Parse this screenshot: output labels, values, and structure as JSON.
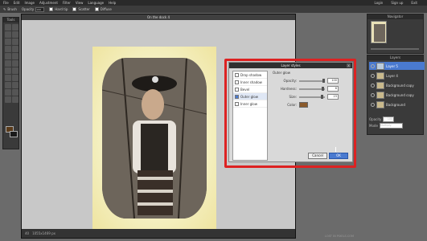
{
  "menubar": {
    "items": [
      "File",
      "Edit",
      "Image",
      "Adjustment",
      "Filter",
      "View",
      "Language",
      "Help"
    ],
    "right": [
      "Login",
      "Sign up",
      "Exit"
    ]
  },
  "options": {
    "brush_label": "Brush",
    "opacity_label": "Opacity",
    "opacity_value": "100",
    "hard_tip": "Hard tip",
    "scatter": "Scatter",
    "diffuse": "Diffuse"
  },
  "tools": {
    "title": "Tools"
  },
  "document": {
    "title": "On the dock 4",
    "zoom": "40",
    "dims": "1055x1469 px"
  },
  "dialog": {
    "title": "Layer styles",
    "close": "x",
    "styles": [
      {
        "label": "Drop shadow",
        "checked": false
      },
      {
        "label": "Inner shadow",
        "checked": false
      },
      {
        "label": "Bevel",
        "checked": false
      },
      {
        "label": "Outer glow",
        "checked": true
      },
      {
        "label": "Inner glow",
        "checked": false
      }
    ],
    "section": "Outer glow",
    "opacity_label": "Opacity:",
    "opacity_value": "100",
    "hardness_label": "Hardness:",
    "hardness_value": "6",
    "size_label": "Size:",
    "size_value": "23",
    "color_label": "Color:",
    "color_value": "#8a5a2b",
    "cancel": "Cancel",
    "ok": "OK"
  },
  "navigator": {
    "title": "Navigator"
  },
  "layers": {
    "title": "Layers",
    "rows": [
      {
        "label": "Layer 5",
        "selected": true
      },
      {
        "label": "Layer 4",
        "selected": false
      },
      {
        "label": "Background copy",
        "selected": false
      },
      {
        "label": "Background copy",
        "selected": false
      },
      {
        "label": "Background",
        "selected": false
      }
    ],
    "opacity_label": "Opacity",
    "opacity_value": "100",
    "mode_label": "Mode",
    "mode_value": "Multiply"
  },
  "status": {
    "text": "LOST IN PIXELS.COM"
  }
}
